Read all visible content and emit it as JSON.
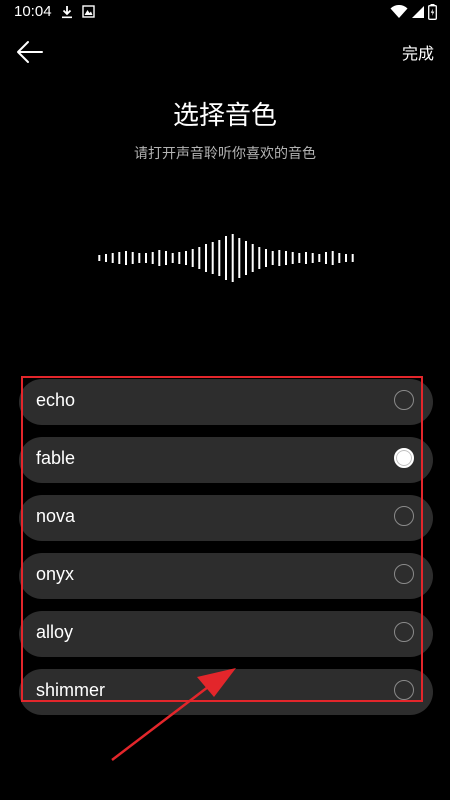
{
  "status_bar": {
    "time": "10:04",
    "icons": [
      "download-icon",
      "image-icon",
      "wifi-icon",
      "signal-icon",
      "battery-icon"
    ]
  },
  "header": {
    "back_icon": "arrow-left-icon",
    "done_label": "完成"
  },
  "page": {
    "title": "选择音色",
    "subtitle": "请打开声音聆听你喜欢的音色"
  },
  "voices": [
    {
      "label": "echo",
      "selected": false
    },
    {
      "label": "fable",
      "selected": true
    },
    {
      "label": "nova",
      "selected": false
    },
    {
      "label": "onyx",
      "selected": false
    },
    {
      "label": "alloy",
      "selected": false
    },
    {
      "label": "shimmer",
      "selected": false
    }
  ],
  "colors": {
    "background": "#000000",
    "item_background": "#2d2d2d",
    "annotation": "#e3262b",
    "subtitle": "#b3b3b3"
  }
}
